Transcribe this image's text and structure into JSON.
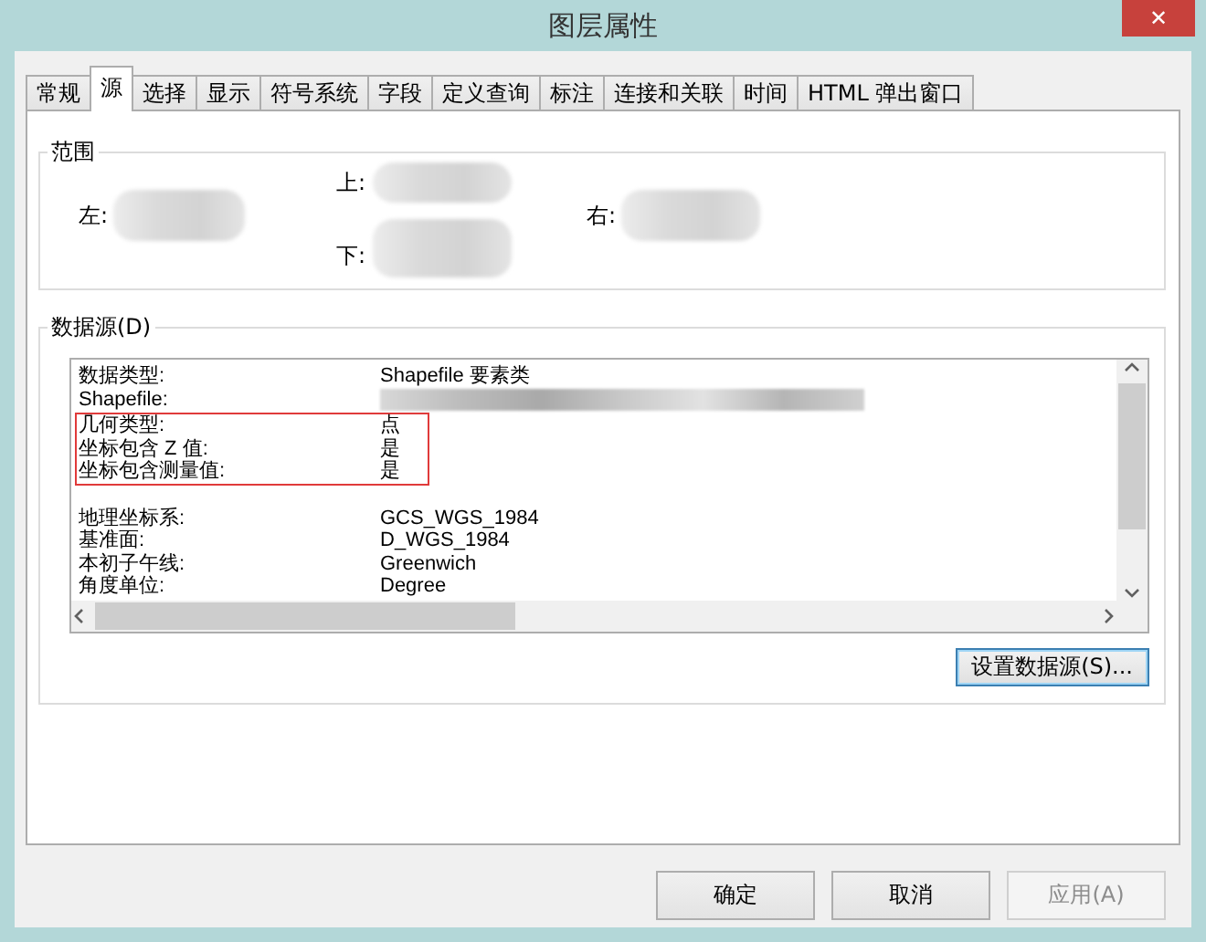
{
  "window": {
    "title": "图层属性",
    "close": "✕"
  },
  "tabs": [
    {
      "label": "常规",
      "selected": false
    },
    {
      "label": "源",
      "selected": true
    },
    {
      "label": "选择",
      "selected": false
    },
    {
      "label": "显示",
      "selected": false
    },
    {
      "label": "符号系统",
      "selected": false
    },
    {
      "label": "字段",
      "selected": false
    },
    {
      "label": "定义查询",
      "selected": false
    },
    {
      "label": "标注",
      "selected": false
    },
    {
      "label": "连接和关联",
      "selected": false
    },
    {
      "label": "时间",
      "selected": false
    },
    {
      "label": "HTML 弹出窗口",
      "selected": false
    }
  ],
  "extent": {
    "title": "范围",
    "top": "上:",
    "left": "左:",
    "right": "右:",
    "bottom": "下:"
  },
  "data_source": {
    "title": "数据源(D)",
    "sections": [
      {
        "rows": [
          {
            "label": "数据类型:",
            "kind": "text",
            "value": "Shapefile 要素类",
            "highlighted": false
          },
          {
            "label": "Shapefile:",
            "kind": "blurred",
            "highlighted": false
          },
          {
            "label": "几何类型:",
            "kind": "text",
            "value": "点",
            "highlighted": true
          },
          {
            "label": "坐标包含 Z 值:",
            "kind": "text",
            "value": "是",
            "highlighted": true
          },
          {
            "label": "坐标包含测量值:",
            "kind": "text",
            "value": "是",
            "highlighted": true
          }
        ]
      },
      {
        "rows": [
          {
            "label": "地理坐标系:",
            "kind": "text",
            "value": "GCS_WGS_1984",
            "highlighted": false
          },
          {
            "label": "基准面:",
            "kind": "text",
            "value": "D_WGS_1984",
            "highlighted": false
          },
          {
            "label": "本初子午线:",
            "kind": "text",
            "value": "Greenwich",
            "highlighted": false
          },
          {
            "label": "角度单位:",
            "kind": "text",
            "value": "Degree",
            "highlighted": false
          }
        ]
      }
    ],
    "set_button": "设置数据源(S)..."
  },
  "buttons": [
    {
      "label": "确定",
      "disabled": false
    },
    {
      "label": "取消",
      "disabled": false
    },
    {
      "label": "应用(A)",
      "disabled": true
    }
  ]
}
